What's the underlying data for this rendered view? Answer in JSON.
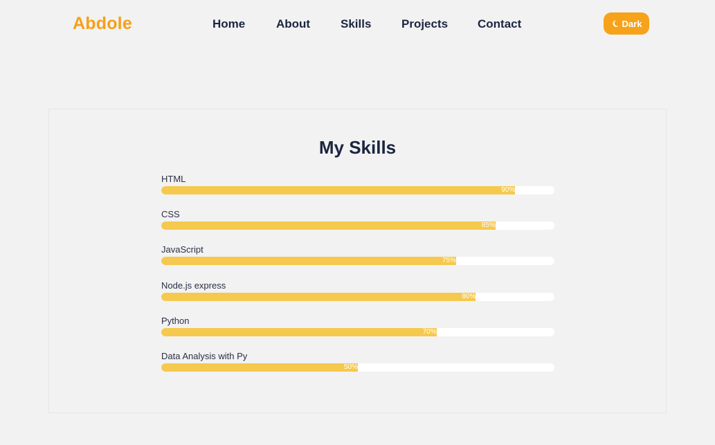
{
  "header": {
    "logo": "Abdole",
    "nav": {
      "home": "Home",
      "about": "About",
      "skills": "Skills",
      "projects": "Projects",
      "contact": "Contact"
    },
    "theme_toggle": {
      "label": "Dark",
      "icon": "moon-icon"
    }
  },
  "skills_section": {
    "title": "My Skills",
    "items": [
      {
        "name": "HTML",
        "percent_label": "90%",
        "level": 0.9
      },
      {
        "name": "CSS",
        "percent_label": "85%",
        "level": 0.85
      },
      {
        "name": "JavaScript",
        "percent_label": "75%",
        "level": 0.75
      },
      {
        "name": "Node.js express",
        "percent_label": "80%",
        "level": 0.8
      },
      {
        "name": "Python",
        "percent_label": "70%",
        "level": 0.7
      },
      {
        "name": "Data Analysis with Py",
        "percent_label": "50%",
        "level": 0.5
      }
    ]
  },
  "colors": {
    "accent": "#f7a21b",
    "bar_fill": "#f5c94e",
    "bar_track": "#ffffff",
    "heading": "#1b2540",
    "background": "#f2f2f2"
  }
}
